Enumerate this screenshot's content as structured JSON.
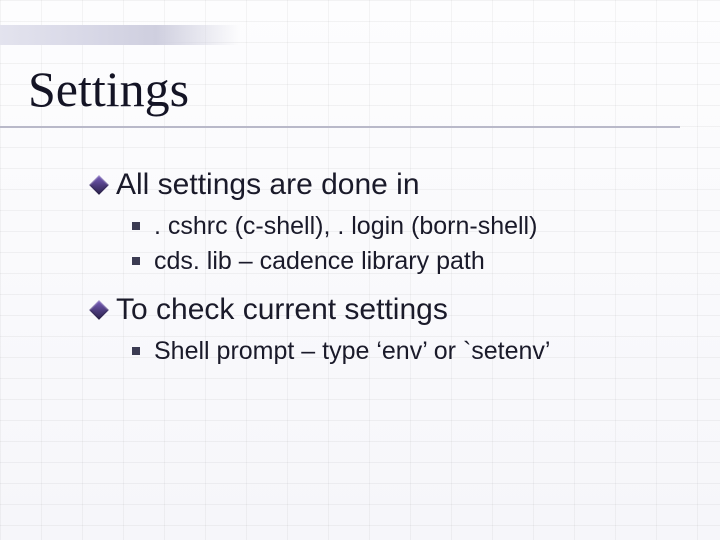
{
  "title": "Settings",
  "content": {
    "items": [
      {
        "text": "All settings are done in",
        "sub": [
          ". cshrc (c-shell), . login (born-shell)",
          "cds. lib – cadence library path"
        ]
      },
      {
        "text": "To check current settings",
        "sub": [
          "Shell prompt – type ‘env’ or `setenv’"
        ]
      }
    ]
  }
}
